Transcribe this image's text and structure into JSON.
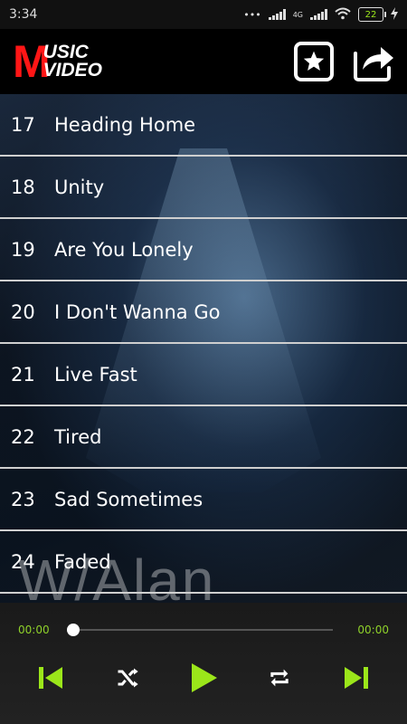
{
  "status_bar": {
    "time": "3:34",
    "signal_label": "4G",
    "battery_level": "22"
  },
  "app": {
    "logo_m": "M",
    "logo_line1": "USIC",
    "logo_line2": "VIDEO",
    "favorites_icon": "star-icon",
    "share_icon": "share-icon"
  },
  "songs": [
    {
      "num": "17",
      "title": "Heading Home"
    },
    {
      "num": "18",
      "title": "Unity"
    },
    {
      "num": "19",
      "title": "Are You Lonely"
    },
    {
      "num": "20",
      "title": "I Don't Wanna Go"
    },
    {
      "num": "21",
      "title": "Live Fast"
    },
    {
      "num": "22",
      "title": "Tired"
    },
    {
      "num": "23",
      "title": "Sad Sometimes"
    },
    {
      "num": "24",
      "title": "Faded"
    }
  ],
  "background_watermark": "W/Alan",
  "player": {
    "current_time": "00:00",
    "total_time": "00:00",
    "progress": 0,
    "accent_color": "#9be61a"
  }
}
